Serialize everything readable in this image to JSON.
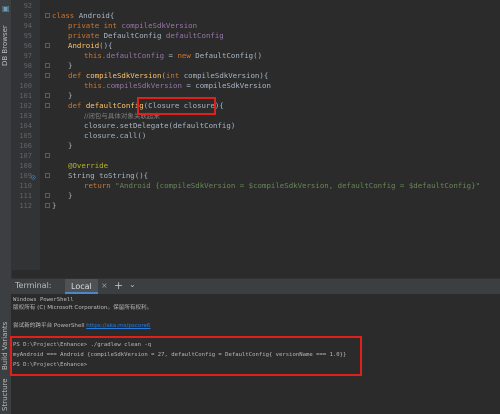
{
  "sidebar": {
    "top_tool": "DB Browser",
    "bottom_tools": [
      "Build Variants",
      "Structure"
    ]
  },
  "editor": {
    "line_numbers": [
      "92",
      "93",
      "94",
      "95",
      "96",
      "97",
      "98",
      "99",
      "100",
      "101",
      "102",
      "103",
      "104",
      "105",
      "106",
      "107",
      "108",
      "109",
      "110",
      "111",
      "112"
    ],
    "lines": {
      "l92": "",
      "l93_kw": "class ",
      "l93_name": "Android{",
      "l94_kw": "private int ",
      "l94_field": "compileSdkVersion",
      "l95_kw": "private ",
      "l95_type": "DefaultConfig ",
      "l95_field": "defaultConfig",
      "l96_fn": "Android",
      "l96_rest": "(){",
      "l97_kw": "this.",
      "l97_field": "defaultConfig",
      "l97_mid": " = ",
      "l97_kw2": "new ",
      "l97_rest": "DefaultConfig()",
      "l98": "}",
      "l99_kw": "def ",
      "l99_fn": "compileSdkVersion",
      "l99_mid": "(",
      "l99_kw2": "int ",
      "l99_rest": "compileSdkVersion){",
      "l100_kw": "this.",
      "l100_field": "compileSdkVersion",
      "l100_rest": " = compileSdkVersion",
      "l101": "}",
      "l102_kw": "def ",
      "l102_fn": "defaultConfig",
      "l102_rest": "(Closure closure){",
      "l103_cmt": "//闭包与具体对象关联起来",
      "l104": "closure.setDelegate(defaultConfig)",
      "l105": "closure.call()",
      "l106": "}",
      "l107": "",
      "l108_anno": "@Override",
      "l109_rest": "String toString(){",
      "l110_kw": "return ",
      "l110_str": "\"Android {compileSdkVersion = $compileSdkVersion, defaultConfig = $defaultConfig}\"",
      "l111": "}",
      "l112": "}"
    }
  },
  "terminal": {
    "label": "Terminal:",
    "tab": "Local",
    "close": "×",
    "add": "+",
    "menu": "⌄",
    "lines": {
      "t1": "Windows PowerShell",
      "t2": "版权所有 (C) Microsoft Corporation。保留所有权利。",
      "t3": "",
      "t4_pre": "尝试新的跨平台 PowerShell ",
      "t4_link": "https://aka.ms/pscore6",
      "t5": "",
      "t6": "PS D:\\Project\\Enhance> ./gradlew clean -q",
      "t7": "myAndroid === Android {compileSdkVersion = 27, defaultConfig = DefaultConfig{ versionName === 1.0}}",
      "t8": "PS D:\\Project\\Enhance>"
    }
  },
  "colors": {
    "highlight_box": "#e0201c",
    "background": "#2b2b2b"
  }
}
